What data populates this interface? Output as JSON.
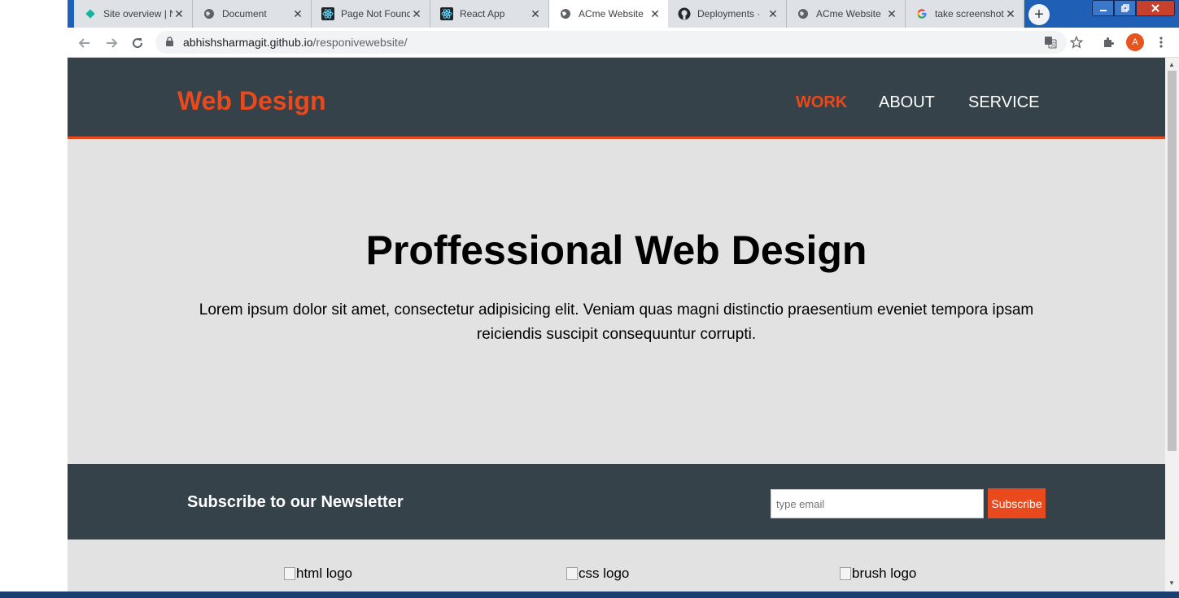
{
  "browser": {
    "tabs": [
      {
        "label": "Site overview | N",
        "icon": "netlify-diamond-icon"
      },
      {
        "label": "Document",
        "icon": "globe-icon"
      },
      {
        "label": "Page Not Found",
        "icon": "react-icon"
      },
      {
        "label": "React App",
        "icon": "react-icon"
      },
      {
        "label": "ACme Website",
        "icon": "globe-icon",
        "active": true
      },
      {
        "label": "Deployments · ",
        "icon": "github-icon"
      },
      {
        "label": "ACme Website",
        "icon": "globe-icon"
      },
      {
        "label": "take screenshot",
        "icon": "google-icon"
      }
    ],
    "close_glyph": "✕",
    "new_tab_glyph": "+",
    "url_host": "abhishsharmagit.github.io",
    "url_path": "/responivewebsite/",
    "avatar_letter": "A"
  },
  "site": {
    "brand": "Web Design",
    "nav": [
      {
        "label": "WORK",
        "current": true
      },
      {
        "label": "ABOUT"
      },
      {
        "label": "SERVICE"
      }
    ],
    "hero_title": "Proffessional Web Design",
    "hero_text": "Lorem ipsum dolor sit amet, consectetur adipisicing elit. Veniam quas magni distinctio praesentium eveniet tempora ipsam reiciendis suscipit consequuntur corrupti.",
    "newsletter": {
      "title": "Subscribe to our Newsletter",
      "email_placeholder": "type email",
      "button": "Subscribe"
    },
    "logos": [
      {
        "alt": "html logo"
      },
      {
        "alt": "css logo"
      },
      {
        "alt": "brush logo"
      }
    ]
  },
  "colors": {
    "accent": "#e8491d",
    "header_bg": "#35424a",
    "page_bg": "#e2e2e2"
  }
}
